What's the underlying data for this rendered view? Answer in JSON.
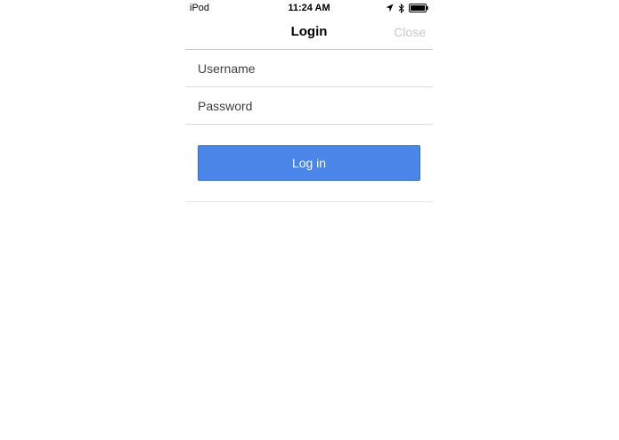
{
  "status_bar": {
    "carrier": "iPod",
    "time": "11:24 AM",
    "icons": [
      "location-arrow-icon",
      "bluetooth-icon",
      "battery-icon"
    ]
  },
  "navbar": {
    "title": "Login",
    "close_label": "Close"
  },
  "form": {
    "username": {
      "placeholder": "Username",
      "value": ""
    },
    "password": {
      "placeholder": "Password",
      "value": ""
    },
    "login_label": "Log in"
  },
  "colors": {
    "button": "#4a86e8",
    "close_text": "#c7c7cc",
    "divider": "#c8c8cc"
  }
}
